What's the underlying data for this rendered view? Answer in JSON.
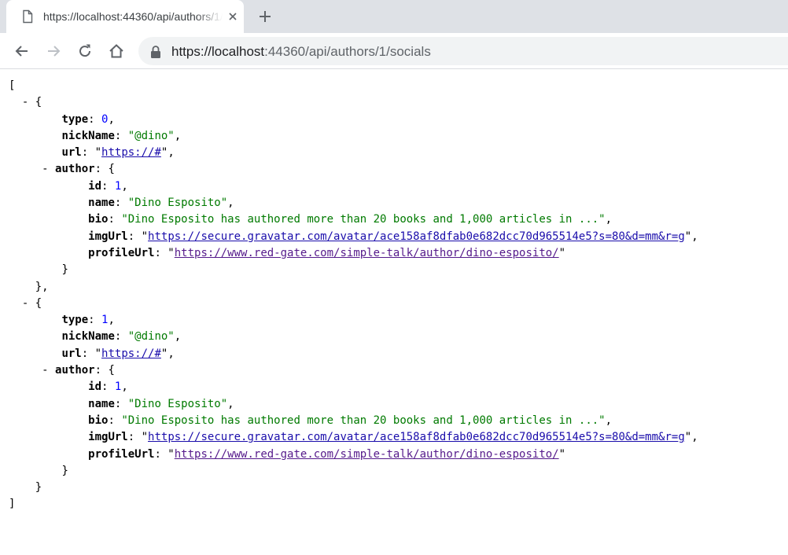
{
  "tab": {
    "title": "https://localhost:44360/api/authors/1/socials",
    "icon": "document-icon"
  },
  "toolbar": {
    "url_prefix": "https://localhost",
    "url_rest": ":44360/api/authors/1/socials"
  },
  "json": {
    "open_bracket": "[",
    "close_bracket": "]",
    "items": [
      {
        "toggle": "- {",
        "type_key": "type",
        "type_val": "0",
        "nick_key": "nickName",
        "nick_val": "\"@dino\"",
        "url_key": "url",
        "url_val": "https://#",
        "author_toggle": "-",
        "author_key": "author",
        "id_key": "id",
        "id_val": "1",
        "name_key": "name",
        "name_val": "\"Dino Esposito\"",
        "bio_key": "bio",
        "bio_val": "\"Dino Esposito has authored more than 20 books and 1,000 articles in ...\"",
        "img_key": "imgUrl",
        "img_val": "https://secure.gravatar.com/avatar/ace158af8dfab0e682dcc70d965514e5?s=80&d=mm&r=g",
        "profile_key": "profileUrl",
        "profile_val": "https://www.red-gate.com/simple-talk/author/dino-esposito/",
        "author_close": "}",
        "close": "},"
      },
      {
        "toggle": "- {",
        "type_key": "type",
        "type_val": "1",
        "nick_key": "nickName",
        "nick_val": "\"@dino\"",
        "url_key": "url",
        "url_val": "https://#",
        "author_toggle": "-",
        "author_key": "author",
        "id_key": "id",
        "id_val": "1",
        "name_key": "name",
        "name_val": "\"Dino Esposito\"",
        "bio_key": "bio",
        "bio_val": "\"Dino Esposito has authored more than 20 books and 1,000 articles in ...\"",
        "img_key": "imgUrl",
        "img_val": "https://secure.gravatar.com/avatar/ace158af8dfab0e682dcc70d965514e5?s=80&d=mm&r=g",
        "profile_key": "profileUrl",
        "profile_val": "https://www.red-gate.com/simple-talk/author/dino-esposito/",
        "author_close": "}",
        "close": "}"
      }
    ]
  }
}
